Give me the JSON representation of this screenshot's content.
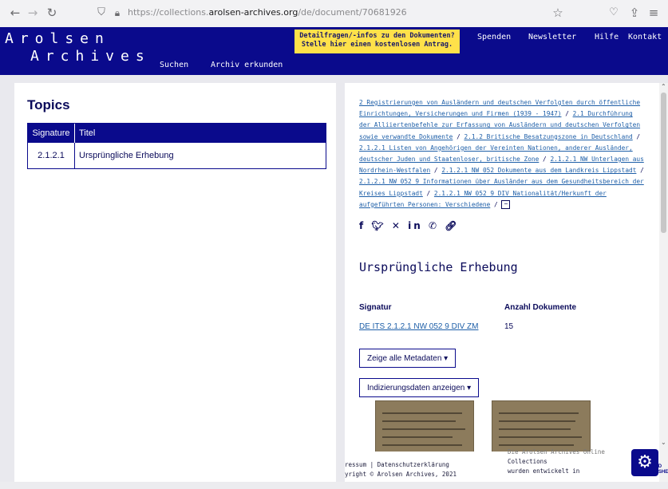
{
  "browser": {
    "url_prefix": "https://collections.",
    "url_host": "arolsen-archives.org",
    "url_path": "/de/document/70681926"
  },
  "header": {
    "logo_line1": "Arolsen",
    "logo_line2": "Archives",
    "nav": {
      "search": "Suchen",
      "explore": "Archiv erkunden",
      "donate": "Spenden",
      "newsletter": "Newsletter",
      "help": "Hilfe",
      "contact": "Kontakt"
    },
    "promo_line1": "Detailfragen/-infos zu den Dokumenten?",
    "promo_line2": "Stelle hier einen kostenlosen Antrag."
  },
  "topics": {
    "title": "Topics",
    "columns": [
      "Signature",
      "Titel"
    ],
    "rows": [
      {
        "signature": "2.1.2.1",
        "title": "Ursprüngliche Erhebung"
      }
    ]
  },
  "breadcrumb": {
    "items": [
      "2 Registrierungen von Ausländern und deutschen Verfolgten durch öffentliche Einrichtungen, Versicherungen und Firmen (1939 - 1947)",
      "2.1 Durchführung der Alliiertenbefehle zur Erfassung von Ausländern und deutschen Verfolgten sowie verwandte Dokumente",
      "2.1.2 Britische Besatzungszone in Deutschland",
      "2.1.2.1 Listen von Angehörigen der Vereinten Nationen, anderer Ausländer, deutscher Juden und Staatenloser, britische Zone",
      "2.1.2.1 NW Unterlagen aus Nordrhein-Westfalen",
      "2.1.2.1 NW 052 Dokumente aus dem Landkreis Lippstadt",
      "2.1.2.1 NW 052 9 Informationen über Ausländer aus dem Gesundheitsbereich der Kreises Lippstadt",
      "2.1.2.1 NW 052 9 DIV Nationalität/Herkunft der aufgeführten Personen: Verschiedene"
    ],
    "separator": "/",
    "collapse_symbol": "−"
  },
  "share_icons": [
    "facebook-icon",
    "twitter-icon",
    "x-icon",
    "linkedin-icon",
    "whatsapp-icon",
    "link-icon"
  ],
  "document": {
    "title": "Ursprüngliche Erhebung",
    "signatur_label": "Signatur",
    "signatur_value": "DE ITS 2.1.2.1 NW 052 9 DIV ZM",
    "count_label": "Anzahl Dokumente",
    "count_value": "15",
    "metadata_button": "Zeige alle Metadaten ▾",
    "indexing_button": "Indizierungsdaten anzeigen ▾"
  },
  "footer": {
    "line1_left": "ressum  |  Datenschutzerklärung",
    "line2_left": "yright © Arolsen Archives, 2021",
    "line0_right": "Die Arolsen Archives Online",
    "line1_right": "Collections",
    "line2_right": "wurden entwickelt in"
  },
  "badge": {
    "partner": "YAD VASHEM",
    "gear_icon": "gear-icon"
  },
  "colors": {
    "brand_blue": "#0a0a8c",
    "promo_yellow": "#ffe14a",
    "link_blue": "#1e5fa8"
  }
}
